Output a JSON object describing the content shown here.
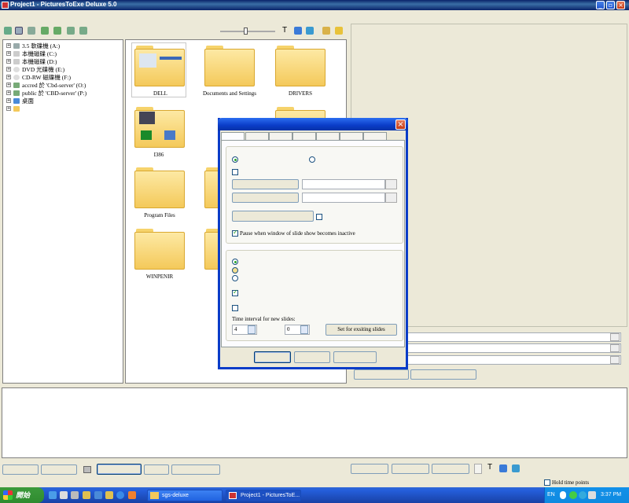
{
  "window": {
    "title": "Project1 - PicturesToExe Deluxe 5.0"
  },
  "tree": [
    {
      "label": "3.5 軟碟機 (A:)"
    },
    {
      "label": "本機磁碟 (C:)"
    },
    {
      "label": "本機磁碟 (D:)"
    },
    {
      "label": "DVD 光碟機 (E:)"
    },
    {
      "label": "CD-RW 磁碟機 (F:)"
    },
    {
      "label": "accred 於 'Cbd-server' (O:)"
    },
    {
      "label": "public 於 'CBD-server' (P:)"
    },
    {
      "label": "桌面"
    },
    {
      "label": ""
    }
  ],
  "folders": [
    {
      "label": "DELL"
    },
    {
      "label": "Documents and Settings"
    },
    {
      "label": "DRIVERS"
    },
    {
      "label": "I386"
    },
    {
      "label": "Program Files"
    },
    {
      "label": "WINPENIR"
    }
  ],
  "toolbar": {
    "text_tool_label": "T"
  },
  "dialog": {
    "pause_label": "Pause when window of slide show becomes inactive",
    "time_interval_label": "Time interval for new slides:",
    "interval_value_1": "4",
    "interval_value_2": "0",
    "set_existing_label": "Set for exsiting slides"
  },
  "bottom": {
    "text_tool_label": "T",
    "hold_time_points_label": "Hold time points"
  },
  "taskbar": {
    "start_label": "開始",
    "tasks": [
      {
        "label": "sgs-deluxe"
      },
      {
        "label": "Project1 - PicturesToE..."
      }
    ],
    "lang": "EN",
    "clock": "3:37 PM"
  }
}
